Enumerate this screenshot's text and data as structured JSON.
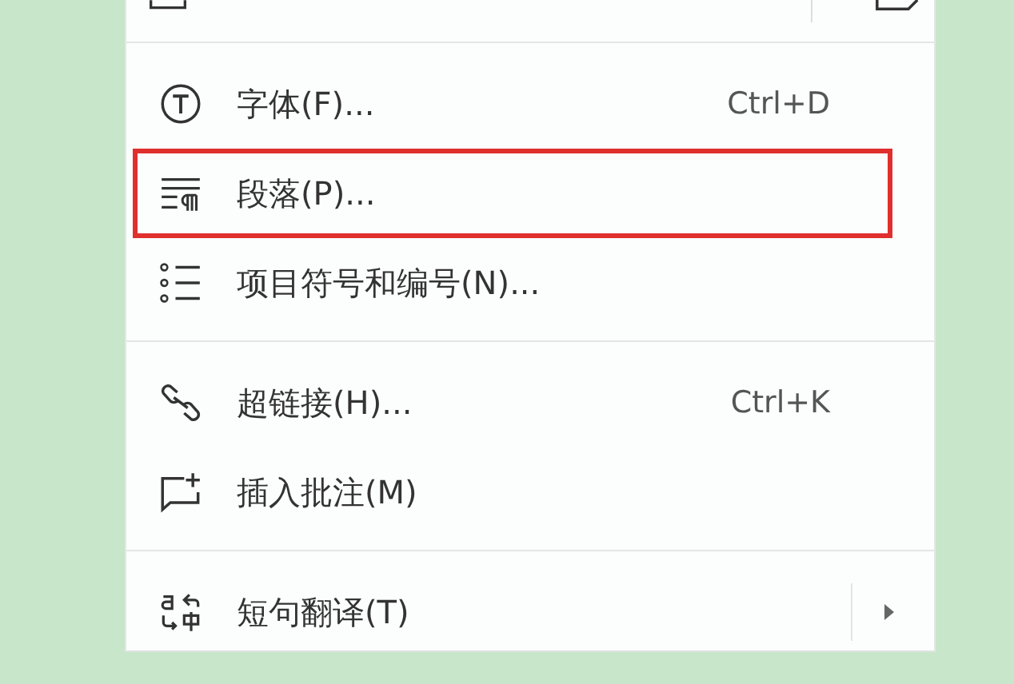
{
  "menu": {
    "groups": [
      {
        "items": [
          {
            "kind": "font",
            "label": "字体(F)...",
            "shortcut": "Ctrl+D",
            "highlighted": false,
            "has_submenu": false
          },
          {
            "kind": "paragraph",
            "label": "段落(P)...",
            "highlighted": true,
            "has_submenu": false
          },
          {
            "kind": "bullets",
            "label": "项目符号和编号(N)...",
            "highlighted": false,
            "has_submenu": false
          }
        ]
      },
      {
        "items": [
          {
            "kind": "link",
            "label": "超链接(H)...",
            "shortcut": "Ctrl+K",
            "highlighted": false,
            "has_submenu": false
          },
          {
            "kind": "comment",
            "label": "插入批注(M)",
            "highlighted": false,
            "has_submenu": false
          }
        ]
      },
      {
        "items": [
          {
            "kind": "translate",
            "label": "短句翻译(T)",
            "highlighted": false,
            "has_submenu": true
          }
        ]
      }
    ]
  }
}
